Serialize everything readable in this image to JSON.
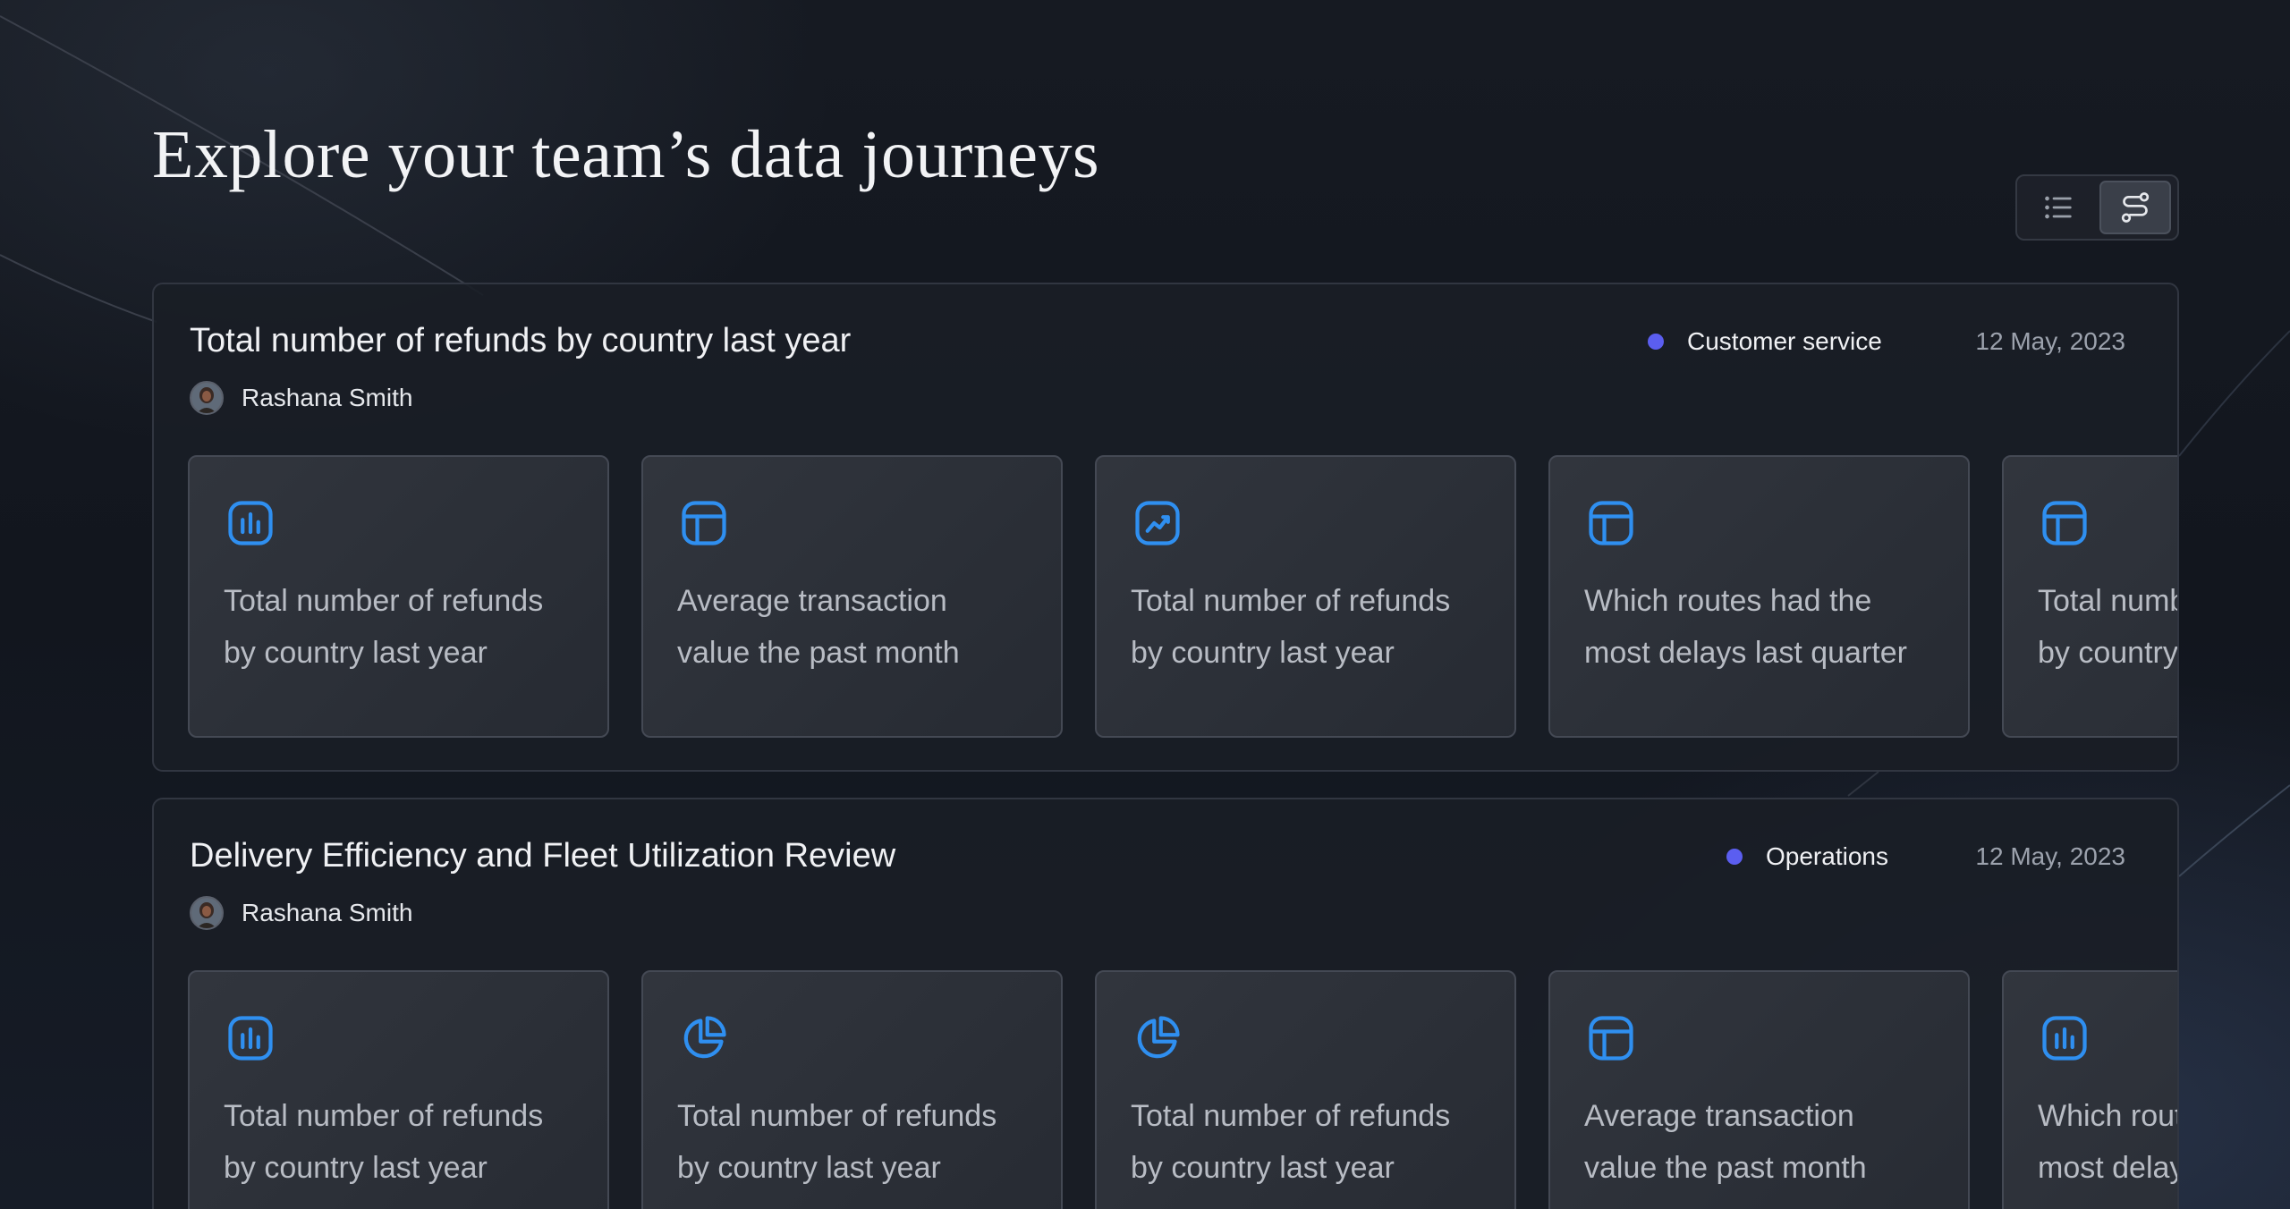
{
  "page": {
    "title": "Explore your team’s data journeys"
  },
  "view_toggle": {
    "list_icon": "list-icon",
    "journey_icon": "route-icon",
    "active": "journey"
  },
  "colors": {
    "accent_icon": "#2f8ff0",
    "tag_dot": "#5b5ef0",
    "background": "#12161e"
  },
  "journeys": [
    {
      "title": "Total number of refunds by country last year",
      "author": "Rashana Smith",
      "tag": "Customer service",
      "date": "12 May, 2023",
      "cards": [
        {
          "icon": "bar-chart-icon",
          "line1": "Total number of refunds",
          "line2": "by country last year"
        },
        {
          "icon": "table-layout-icon",
          "line1": "Average transaction",
          "line2": "value the past month"
        },
        {
          "icon": "line-chart-icon",
          "line1": "Total number of refunds",
          "line2": "by country last year"
        },
        {
          "icon": "table-layout-icon",
          "line1": "Which routes had the",
          "line2": "most delays last quarter"
        },
        {
          "icon": "table-layout-icon",
          "line1": "Total number of refunds",
          "line2": "by country last year"
        }
      ]
    },
    {
      "title": "Delivery Efficiency and Fleet Utilization Review",
      "author": "Rashana Smith",
      "tag": "Operations",
      "date": "12 May, 2023",
      "cards": [
        {
          "icon": "bar-chart-icon",
          "line1": "Total number of refunds",
          "line2": "by country last year"
        },
        {
          "icon": "pie-chart-icon",
          "line1": "Total number of refunds",
          "line2": "by country last year"
        },
        {
          "icon": "pie-chart-icon",
          "line1": "Total number of refunds",
          "line2": "by country last year"
        },
        {
          "icon": "table-layout-icon",
          "line1": "Average transaction",
          "line2": "value the past month"
        },
        {
          "icon": "bar-chart-icon",
          "line1": "Which routes had the",
          "line2": "most delays last quarter"
        }
      ]
    }
  ]
}
